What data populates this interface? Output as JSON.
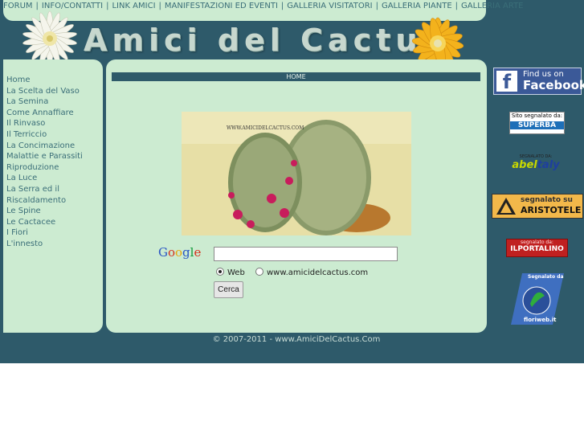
{
  "topnav": {
    "items": [
      "FORUM",
      "INFO/CONTATTI",
      "LINK AMICI",
      "MANIFESTAZIONI ED EVENTI",
      "GALLERIA VISITATORI",
      "GALLERIA PIANTE",
      "GALLERIA ARTE"
    ],
    "separator": "|"
  },
  "banner": {
    "title": "Amici del Cactus"
  },
  "sidebar": {
    "items": [
      "Home",
      "La Scelta del Vaso",
      "La Semina",
      "Come Annaffiare",
      "Il Rinvaso",
      "Il Terriccio",
      "La Concimazione",
      "Malattie e Parassiti",
      "Riproduzione",
      "La Luce",
      "La Serra ed il",
      "Riscaldamento",
      "Le Spine",
      "Le Cactacee",
      "I Fiori",
      "L'innesto"
    ]
  },
  "main": {
    "breadcrumb": "HOME",
    "photo_caption": "WWW.AMICIDELCACTUS.COM"
  },
  "search": {
    "logo": "Google",
    "input_value": "",
    "option_web": "Web",
    "option_site": "www.amicidelcactus.com",
    "button_label": "Cerca"
  },
  "footer": {
    "copyright": "© 2007-2011 - www.AmiciDelCactus.Com"
  },
  "badges": {
    "facebook": {
      "line1": "Find us on",
      "line2": "Facebook"
    },
    "superba": {
      "line1": "Sito segnalato da:",
      "line2": "SUPERBA"
    },
    "abeltaly": {
      "line1": "SEGNALATO DA:",
      "line2_a": "abel",
      "line2_b": "taly"
    },
    "aristotele": {
      "line1": "segnalato su",
      "line2": "ARISTOTELE"
    },
    "portalino": {
      "line1": "segnalato da:",
      "line2": "ILPORTALINO"
    },
    "floriweb": {
      "line1": "Segnalato da",
      "line2": "floriweb.it"
    }
  },
  "colors": {
    "page_bg": "#2e5a6a",
    "panel": "#ccebd1",
    "link": "#3a6e78",
    "facebook": "#3b5998"
  }
}
